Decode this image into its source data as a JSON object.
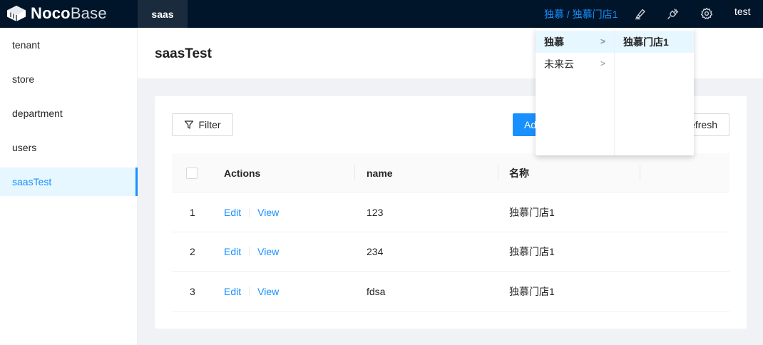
{
  "header": {
    "logo_bold": "Noco",
    "logo_light": "Base",
    "active_tab": "saas",
    "tenant_path": "独慕 / 独慕门店1",
    "user": "test"
  },
  "sidebar": {
    "items": [
      {
        "label": "tenant"
      },
      {
        "label": "store"
      },
      {
        "label": "department"
      },
      {
        "label": "users"
      },
      {
        "label": "saasTest"
      }
    ]
  },
  "page": {
    "title": "saasTest"
  },
  "toolbar": {
    "filter_label": "Filter",
    "add_label": "Add new",
    "refresh_label": "Refresh"
  },
  "table": {
    "columns": [
      "Actions",
      "name",
      "名称"
    ],
    "action_edit": "Edit",
    "action_view": "View",
    "rows": [
      {
        "index": "1",
        "name": "123",
        "title": "独慕门店1"
      },
      {
        "index": "2",
        "name": "234",
        "title": "独慕门店1"
      },
      {
        "index": "3",
        "name": "fdsa",
        "title": "独慕门店1"
      }
    ]
  },
  "cascader": {
    "level1": [
      {
        "label": "独慕",
        "arrow": ">"
      },
      {
        "label": "未来云",
        "arrow": ">"
      }
    ],
    "level2": [
      {
        "label": "独慕门店1"
      }
    ]
  },
  "colors": {
    "header_bg": "#001529",
    "primary": "#1890ff",
    "selected_bg": "#e6f7ff"
  },
  "icons": {
    "logo": "noco-logo-icon",
    "designer": "highlighter-icon",
    "plugins": "plug-icon",
    "settings": "gear-icon",
    "filter": "filter-funnel-icon"
  }
}
